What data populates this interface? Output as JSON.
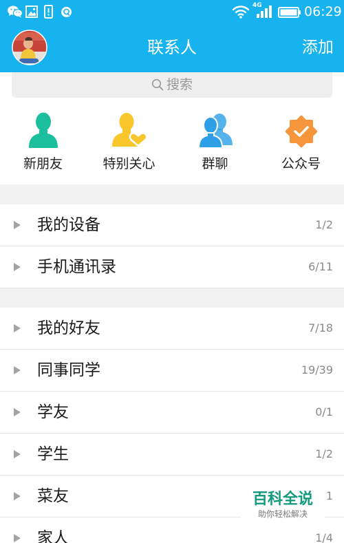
{
  "theme": {
    "primary": "#16b3ef",
    "band": "#f2f2f2",
    "divider": "#e6e6e6"
  },
  "status_bar": {
    "time": "06:29",
    "network": "4G",
    "icons": [
      "wechat-icon",
      "image-icon",
      "sim-alert-icon",
      "notification-icon",
      "wifi-icon",
      "signal-icon",
      "battery-icon"
    ]
  },
  "header": {
    "title": "联系人",
    "add_label": "添加"
  },
  "search": {
    "placeholder": "搜索",
    "icon": "search-icon"
  },
  "quick_actions": [
    {
      "label": "新朋友",
      "icon": "new-friend-icon",
      "color": "#1cbf9d"
    },
    {
      "label": "特别关心",
      "icon": "special-care-icon",
      "color": "#f9c62b"
    },
    {
      "label": "群聊",
      "icon": "group-chat-icon",
      "color": "#2c9fe6"
    },
    {
      "label": "公众号",
      "icon": "official-account-icon",
      "color": "#f6963c"
    }
  ],
  "group_sections": [
    [
      {
        "name": "我的设备",
        "count": "1/2"
      },
      {
        "name": "手机通讯录",
        "count": "6/11"
      }
    ],
    [
      {
        "name": "我的好友",
        "count": "7/18"
      },
      {
        "name": "同事同学",
        "count": "19/39"
      },
      {
        "name": "学友",
        "count": "0/1"
      },
      {
        "name": "学生",
        "count": "1/2"
      },
      {
        "name": "菜友",
        "count": "1"
      },
      {
        "name": "家人",
        "count": "1/4"
      }
    ]
  ],
  "watermark": {
    "title": "百科全说",
    "subtitle": "助你轻松解决",
    "color": "#139a7c"
  }
}
